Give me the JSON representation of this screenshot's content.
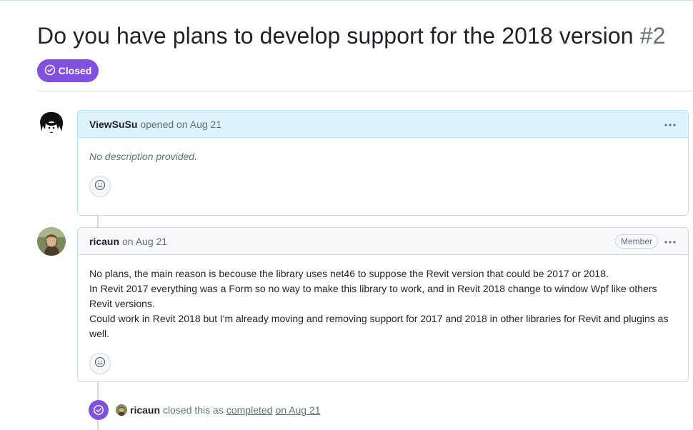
{
  "issue": {
    "title": "Do you have plans to develop support for the 2018 version",
    "number": "#2",
    "state": "Closed",
    "state_color": "#8250df"
  },
  "comments": [
    {
      "user": "ViewSuSu",
      "action": "opened on Aug 21",
      "body": "No description provided.",
      "avatar_icon": "avatar-viewsusu"
    },
    {
      "user": "ricaun",
      "action": "on Aug 21",
      "badge": "Member",
      "body_lines": [
        "No plans, the main reason is becouse the library uses net46 to suppose the Revit version that could be 2017 or 2018.",
        "In Revit 2017 everything was a Form so no way to make this library to work, and in Revit 2018 change to window Wpf like others Revit versions.",
        "Could work in Revit 2018 but I'm already moving and removing support for 2017 and 2018 in other libraries for Revit and plugins as well."
      ],
      "avatar_icon": "avatar-ricaun"
    }
  ],
  "event": {
    "user": "ricaun",
    "text": "closed this as",
    "reason": "completed",
    "date": "on Aug 21"
  },
  "colors": {
    "author_header_bg": "#ddf4ff",
    "header_bg": "#f6f8fa",
    "border": "#d0d7de",
    "muted": "#656d76"
  },
  "icons": [
    "issue-closed-icon",
    "kebab-icon",
    "smiley-icon"
  ]
}
